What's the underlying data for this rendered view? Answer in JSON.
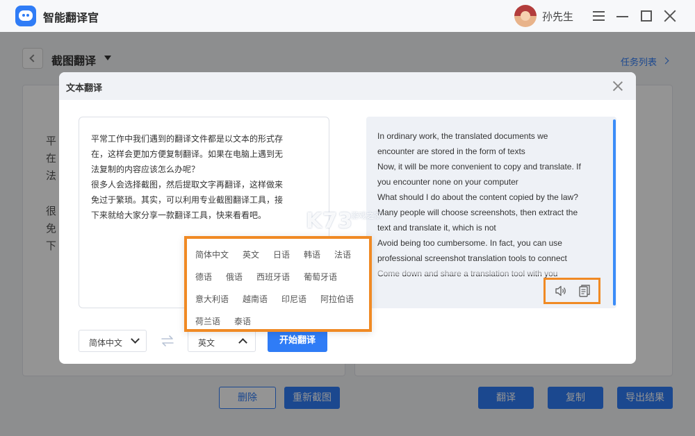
{
  "app": {
    "title": "智能翻译官",
    "user_name": "孙先生"
  },
  "page": {
    "title": "截图翻译",
    "task_list_link": "任务列表",
    "bg_text_lines": [
      "平",
      "在",
      "法",
      "很",
      "免",
      "下"
    ],
    "buttons": {
      "delete": "删除",
      "recapture": "重新截图",
      "translate": "翻译",
      "copy": "复制",
      "export": "导出结果"
    }
  },
  "modal": {
    "title": "文本翻译",
    "source_lines": [
      "平常工作中我们遇到的翻译文件都是以文本的形式存",
      "在，这样会更加方便复制翻译。如果在电脑上遇到无",
      "法复制的内容应该怎么办呢？",
      "很多人会选择截图，然后提取文字再翻译，这样做来",
      "免过于繁琐。其实，可以利用专业截图翻译工具，接",
      "下来就给大家分享一款翻译工具，快来看看吧。"
    ],
    "output_lines": [
      "In ordinary work, the translated documents we",
      "encounter are stored in the form of texts",
      "Now, it will be more convenient to copy and translate. If",
      "you encounter none on your computer",
      "What should I do about the content copied by the law?",
      "Many people will choose screenshots, then extract the",
      "text and translate it, which is not",
      "Avoid being too cumbersome. In fact, you can use",
      "professional screenshot translation tools to connect",
      "Come down and share a translation tool with you"
    ],
    "source_lang": "简体中文",
    "target_lang": "英文",
    "start_button": "开始翻译",
    "language_options": [
      [
        "简体中文",
        "英文",
        "日语",
        "韩语",
        "法语"
      ],
      [
        "德语",
        "俄语",
        "西班牙语",
        "葡萄牙语"
      ],
      [
        "意大利语",
        "越南语",
        "印尼语",
        "阿拉伯语"
      ],
      [
        "荷兰语",
        "泰语"
      ]
    ]
  },
  "watermark": {
    "main": "K73",
    "sub": "游戏之家"
  },
  "colors": {
    "accent": "#2f7cf6",
    "highlight": "#f08a24",
    "overlay": "rgba(0,0,0,0.42)"
  }
}
